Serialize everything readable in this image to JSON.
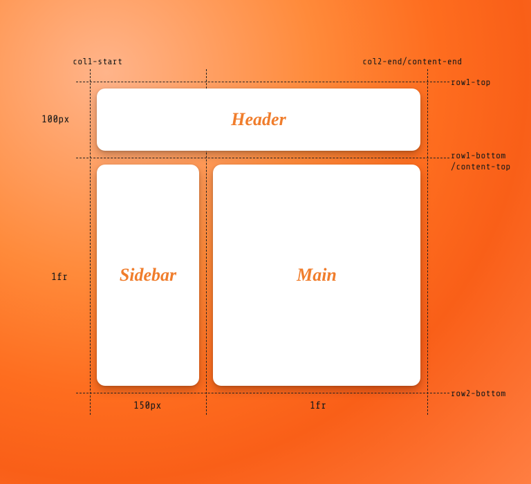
{
  "diagram": {
    "lines": {
      "col1_start": "col1-start",
      "col2_end": "col2-end/content-end",
      "row1_top": "row1-top",
      "row1_bottom": "row1-bottom",
      "content_top": "/content-top",
      "row2_bottom": "row2-bottom"
    },
    "tracks": {
      "row1_size": "100px",
      "row2_size": "1fr",
      "col1_size": "150px",
      "col2_size": "1fr"
    },
    "cards": {
      "header": "Header",
      "sidebar": "Sidebar",
      "main": "Main"
    }
  }
}
